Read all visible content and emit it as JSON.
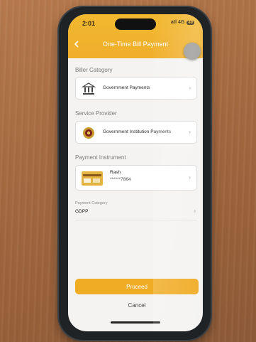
{
  "status_bar": {
    "time": "2:01",
    "signal": "atl 4G",
    "battery": "49"
  },
  "header": {
    "title": "One-Time Bill Payment",
    "back_icon": "chevron-left-icon"
  },
  "biller_category": {
    "label": "Biller Category",
    "value": "Government Payments",
    "icon": "bank-icon"
  },
  "service_provider": {
    "label": "Service Provider",
    "value": "Government Institution Payments",
    "icon": "emblem-icon"
  },
  "payment_instrument": {
    "label": "Payment Instrument",
    "name": "Rash",
    "masked_number": "******7864",
    "icon": "card-icon"
  },
  "payment_category": {
    "label": "Payment Category",
    "value": "GDPP"
  },
  "actions": {
    "proceed": "Proceed",
    "cancel": "Cancel"
  },
  "colors": {
    "accent": "#f0ac25",
    "header": "#f2b830",
    "screen_bg": "#f4f3f1"
  }
}
